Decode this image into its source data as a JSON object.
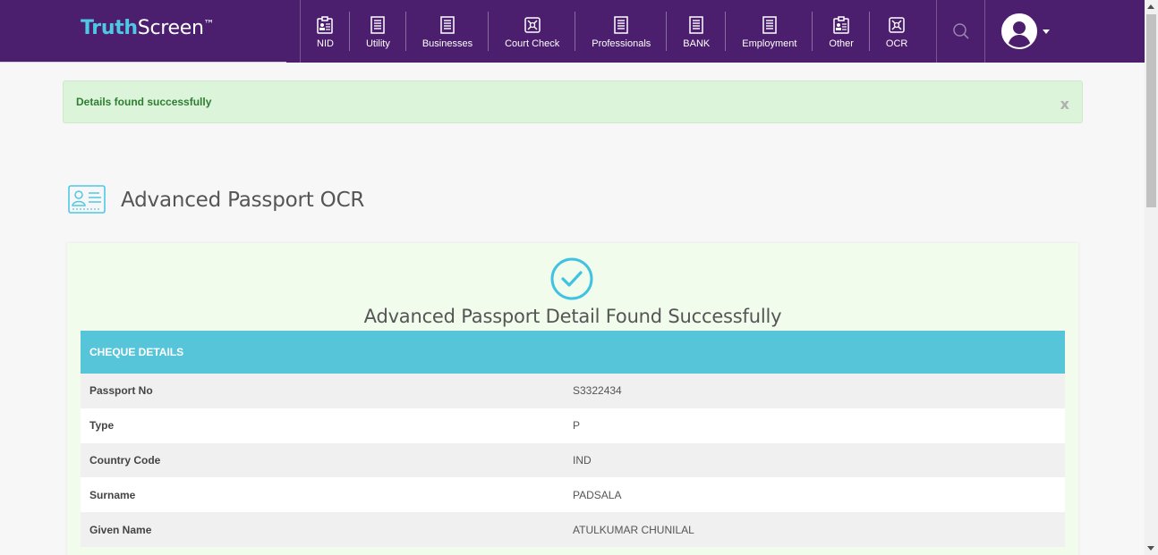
{
  "brand": {
    "part1": "Truth",
    "part2": "Screen",
    "tm": "™"
  },
  "nav": [
    {
      "label": "NID",
      "icon": "id-card-icon"
    },
    {
      "label": "Utility",
      "icon": "document-icon"
    },
    {
      "label": "Businesses",
      "icon": "document-icon"
    },
    {
      "label": "Court Check",
      "icon": "court-check-icon"
    },
    {
      "label": "Professionals",
      "icon": "document-icon"
    },
    {
      "label": "BANK",
      "icon": "document-icon"
    },
    {
      "label": "Employment",
      "icon": "document-icon"
    },
    {
      "label": "Other",
      "icon": "id-card-icon"
    },
    {
      "label": "OCR",
      "icon": "ocr-icon"
    }
  ],
  "alert": {
    "message": "Details found successfully",
    "close": "x"
  },
  "page": {
    "title": "Advanced Passport OCR"
  },
  "result": {
    "heading": "Advanced Passport Detail Found Successfully",
    "table_title": "CHEQUE DETAILS",
    "rows": [
      {
        "label": "Passport No",
        "value": "S3322434"
      },
      {
        "label": "Type",
        "value": "P"
      },
      {
        "label": "Country Code",
        "value": "IND"
      },
      {
        "label": "Surname",
        "value": "PADSALA"
      },
      {
        "label": "Given Name",
        "value": "ATULKUMAR CHUNILAL"
      }
    ]
  },
  "colors": {
    "header": "#4b1e6e",
    "accent": "#57c5d9",
    "success_bg": "#dcf5da",
    "success_text": "#2e7d32"
  }
}
